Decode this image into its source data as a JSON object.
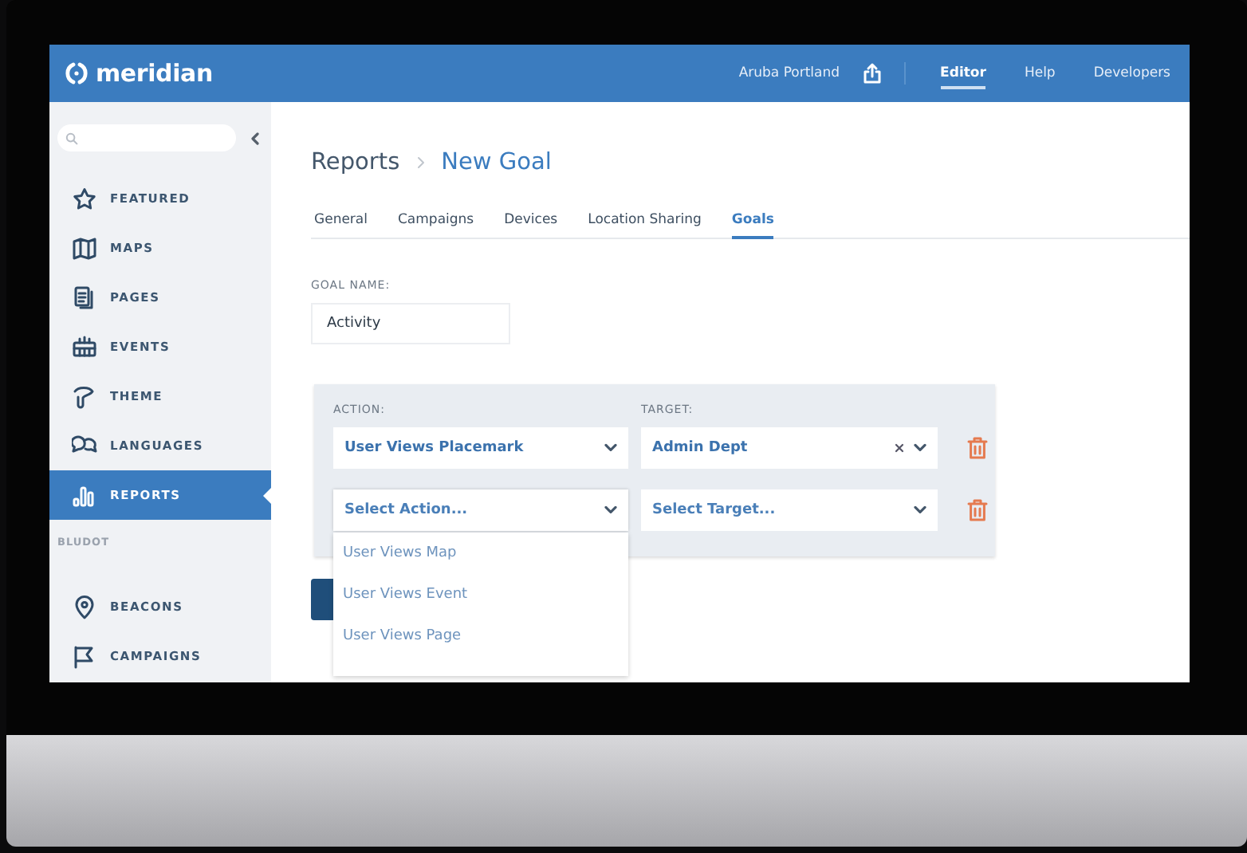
{
  "header": {
    "logo": "meridian",
    "location": "Aruba Portland",
    "nav": [
      {
        "label": "Editor",
        "selected": true
      },
      {
        "label": "Help",
        "selected": false
      },
      {
        "label": "Developers",
        "selected": false
      }
    ]
  },
  "sidebar": {
    "groups": [
      {
        "items": [
          {
            "label": "FEATURED",
            "selected": false
          },
          {
            "label": "MAPS",
            "selected": false
          },
          {
            "label": "PAGES",
            "selected": false
          },
          {
            "label": "EVENTS",
            "selected": false
          },
          {
            "label": "THEME",
            "selected": false
          },
          {
            "label": "LANGUAGES",
            "selected": false
          },
          {
            "label": "REPORTS",
            "selected": true
          }
        ]
      },
      {
        "title": "BLUDOT",
        "items": [
          {
            "label": "BEACONS",
            "selected": false
          },
          {
            "label": "CAMPAIGNS",
            "selected": false
          }
        ]
      }
    ]
  },
  "breadcrumb": [
    "Reports",
    "New Goal"
  ],
  "tabs": [
    {
      "label": "General",
      "selected": false
    },
    {
      "label": "Campaigns",
      "selected": false
    },
    {
      "label": "Devices",
      "selected": false
    },
    {
      "label": "Location Sharing",
      "selected": false
    },
    {
      "label": "Goals",
      "selected": true
    }
  ],
  "goal_name": {
    "label": "GOAL NAME:",
    "value": "Activity"
  },
  "rules": {
    "action_label": "ACTION:",
    "target_label": "TARGET:",
    "rows": [
      {
        "action": {
          "value": "User Views Placemark",
          "open": false
        },
        "target": {
          "value": "Admin Dept",
          "clearable": true
        }
      },
      {
        "action": {
          "placeholder": "Select Action...",
          "open": true,
          "options": [
            "User Views Map",
            "User Views Event",
            "User Views Page"
          ]
        },
        "target": {
          "placeholder": "Select Target...",
          "clearable": false
        }
      }
    ]
  }
}
